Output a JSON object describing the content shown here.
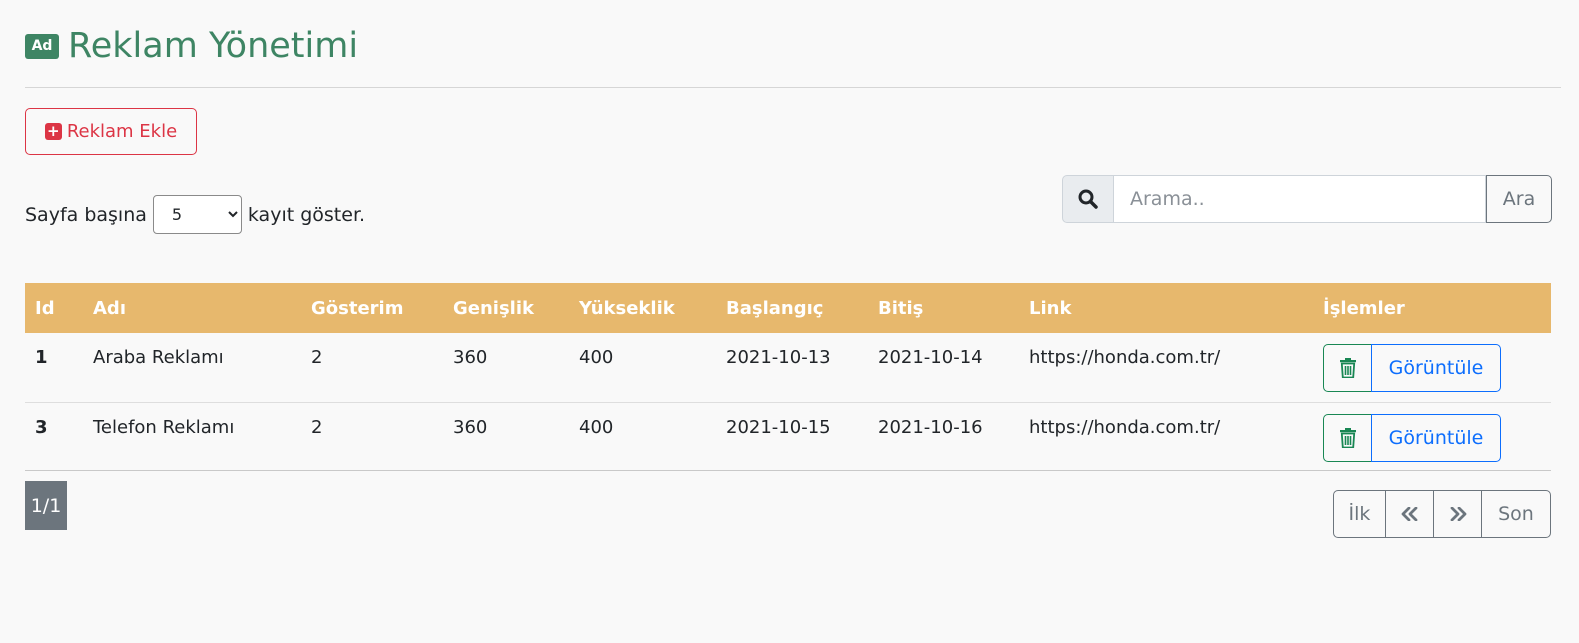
{
  "header": {
    "badge": "Ad",
    "title": "Reklam Yönetimi"
  },
  "actions": {
    "add_label": "Reklam Ekle"
  },
  "per_page": {
    "prefix": "Sayfa başına",
    "selected": "5",
    "suffix": "kayıt göster."
  },
  "search": {
    "placeholder": "Arama..",
    "button_label": "Ara"
  },
  "table": {
    "columns": [
      "Id",
      "Adı",
      "Gösterim",
      "Genişlik",
      "Yükseklik",
      "Başlangıç",
      "Bitiş",
      "Link",
      "İşlemler"
    ],
    "rows": [
      {
        "id": "1",
        "name": "Araba Reklamı",
        "views": "2",
        "width": "360",
        "height": "400",
        "start": "2021-10-13",
        "end": "2021-10-14",
        "link": "https://honda.com.tr/",
        "view_label": "Görüntüle"
      },
      {
        "id": "3",
        "name": "Telefon Reklamı",
        "views": "2",
        "width": "360",
        "height": "400",
        "start": "2021-10-15",
        "end": "2021-10-16",
        "link": "https://honda.com.tr/",
        "view_label": "Görüntüle"
      }
    ]
  },
  "pagination": {
    "count": "1/1",
    "first": "İlk",
    "last": "Son"
  },
  "colors": {
    "accent": "#3e8564",
    "header_bg": "#e7b86d",
    "danger": "#dc3545",
    "primary": "#0d6efd",
    "success": "#198754"
  }
}
